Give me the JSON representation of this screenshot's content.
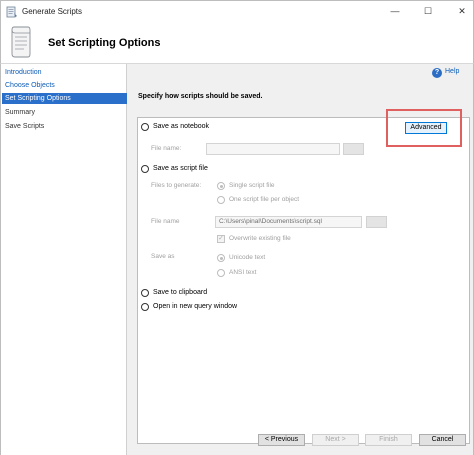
{
  "window": {
    "title": "Generate Scripts",
    "controls": {
      "minimize": "—",
      "maximize": "☐",
      "close": "✕"
    }
  },
  "header": {
    "title": "Set Scripting Options"
  },
  "sidebar": {
    "items": [
      {
        "label": "Introduction",
        "state": "link"
      },
      {
        "label": "Choose Objects",
        "state": "link"
      },
      {
        "label": "Set Scripting Options",
        "state": "active"
      },
      {
        "label": "Summary",
        "state": "normal"
      },
      {
        "label": "Save Scripts",
        "state": "normal"
      }
    ]
  },
  "help": {
    "label": "Help",
    "icon": "?"
  },
  "main": {
    "prompt": "Specify how scripts should be saved.",
    "advanced_label": "Advanced",
    "save_as_notebook": {
      "label": "Save as notebook",
      "file_name_label": "File name:",
      "file_name_value": ""
    },
    "save_as_script_file": {
      "label": "Save as script file",
      "files_to_generate_label": "Files to generate:",
      "single_file_label": "Single script file",
      "one_per_object_label": "One script file per object",
      "file_name_label": "File name",
      "file_name_value": "C:\\Users\\pinal\\Documents\\script.sql",
      "overwrite_label": "Overwrite existing file",
      "save_as_label": "Save as",
      "unicode_label": "Unicode text",
      "ansi_label": "ANSI text"
    },
    "save_to_clipboard_label": "Save to clipboard",
    "open_query_window_label": "Open in new query window"
  },
  "footer": {
    "previous_label": "< Previous",
    "next_label": "Next >",
    "finish_label": "Finish",
    "cancel_label": "Cancel"
  }
}
